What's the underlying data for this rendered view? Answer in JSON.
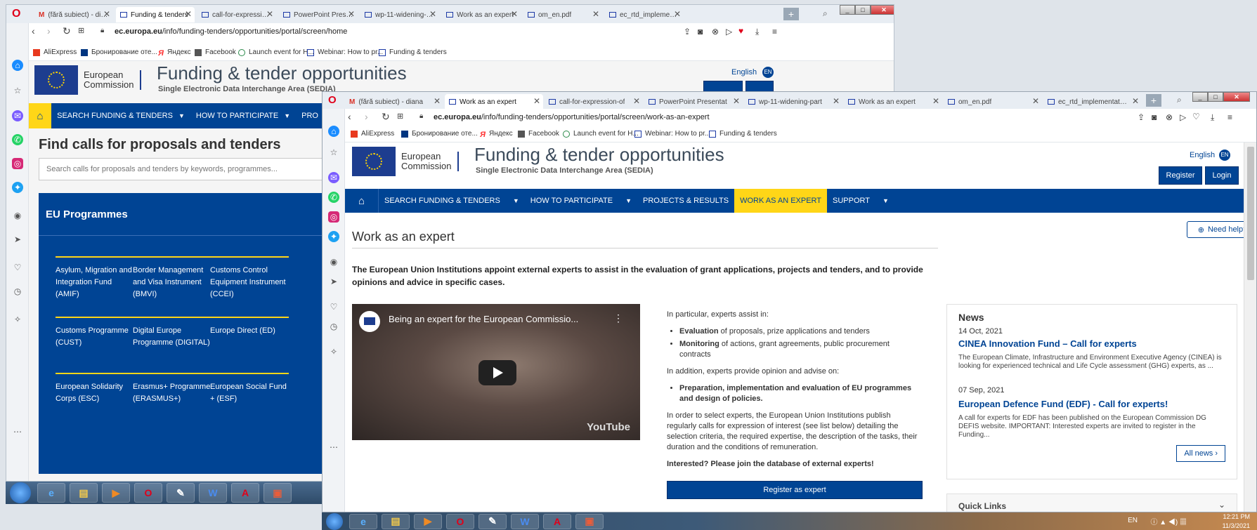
{
  "back": {
    "tabs": [
      "(fără subiect) - diana",
      "Funding & tenders",
      "call-for-expression-of",
      "PowerPoint Presentat",
      "wp-11-widening-part",
      "Work as an expert",
      "om_en.pdf",
      "ec_rtd_implementation"
    ],
    "url_domain": "ec.europa.eu",
    "url_path": "/info/funding-tenders/opportunities/portal/screen/home",
    "bookmarks": [
      "AliExpress",
      "Бронирование оте...",
      "Яндекс",
      "Facebook",
      "Launch event for H...",
      "Webinar: How to pr...",
      "Funding & tenders"
    ],
    "logo_line1": "European",
    "logo_line2": "Commission",
    "title": "Funding & tender opportunities",
    "subtitle": "Single Electronic Data Interchange Area (SEDIA)",
    "lang": "English",
    "lang_code": "EN",
    "nav": [
      "SEARCH FUNDING & TENDERS",
      "HOW TO PARTICIPATE",
      "PRO"
    ],
    "find_title": "Find calls for proposals and tenders",
    "search_placeholder": "Search calls for proposals and tenders by keywords, programmes...",
    "programmes_title": "EU Programmes",
    "programmes": [
      "Asylum, Migration and Integration Fund (AMIF)",
      "Border Management and Visa Instrument (BMVI)",
      "Customs Control Equipment Instrument (CCEI)",
      "Customs Programme (CUST)",
      "Digital Europe Programme (DIGITAL)",
      "Europe Direct (ED)",
      "European Solidarity Corps (ESC)",
      "Erasmus+ Programme (ERASMUS+)",
      "European Social Fund + (ESF)"
    ]
  },
  "front": {
    "tabs": [
      "(fără subiect) - diana",
      "Work as an expert",
      "call-for-expression-of",
      "PowerPoint Presentat",
      "wp-11-widening-part",
      "Work as an expert",
      "om_en.pdf",
      "ec_rtd_implementation"
    ],
    "url_domain": "ec.europa.eu",
    "url_path": "/info/funding-tenders/opportunities/portal/screen/work-as-an-expert",
    "bookmarks": [
      "AliExpress",
      "Бронирование оте...",
      "Яндекс",
      "Facebook",
      "Launch event for H...",
      "Webinar: How to pr...",
      "Funding & tenders"
    ],
    "logo_line1": "European",
    "logo_line2": "Commission",
    "title": "Funding & tender opportunities",
    "subtitle": "Single Electronic Data Interchange Area (SEDIA)",
    "lang": "English",
    "lang_code": "EN",
    "register": "Register",
    "login": "Login",
    "nav": [
      "SEARCH FUNDING & TENDERS",
      "HOW TO PARTICIPATE",
      "PROJECTS & RESULTS",
      "WORK AS AN EXPERT",
      "SUPPORT"
    ],
    "need_help": "Need help?",
    "page_title": "Work as an expert",
    "intro": "The European Union Institutions appoint external experts to assist in the evaluation of grant applications, projects and tenders, and to provide opinions and advice in specific cases.",
    "video_title": "Being an expert for the European Commissio...",
    "video_brand": "YouTube",
    "assist_intro": "In particular, experts assist in:",
    "assist_items": [
      {
        "bold": "Evaluation",
        "rest": " of proposals, prize applications and tenders"
      },
      {
        "bold": "Monitoring",
        "rest": " of actions, grant agreements, public procurement contracts"
      }
    ],
    "advise_intro": "In addition, experts provide opinion and advise on:",
    "advise_item": "Preparation, implementation and evaluation of EU programmes and design of policies.",
    "select_text": "In order to select experts, the European Union Institutions publish regularly calls for expression of interest (see list below) detailing the selection criteria, the required expertise, the description of the tasks, their duration and the conditions of remuneration.",
    "interested": "Interested? Please join the database of external experts!",
    "register_expert": "Register as expert",
    "news_title": "News",
    "news": [
      {
        "date": "14 Oct, 2021",
        "title": "CINEA Innovation Fund – Call for experts",
        "body": "The European Climate, Infrastructure and Environment Executive Agency (CINEA) is looking for experienced technical and Life Cycle assessment (GHG) experts, as ..."
      },
      {
        "date": "07 Sep, 2021",
        "title": "European Defence Fund (EDF) - Call for experts!",
        "body": "A call for experts for EDF has been published on the European Commission DG DEFIS website. IMPORTANT: Interested experts are invited to register in the Funding..."
      }
    ],
    "all_news": "All news ›",
    "quick_links": "Quick Links"
  },
  "taskbar": {
    "lang": "EN",
    "time": "12:21 PM",
    "date": "11/3/2021"
  }
}
